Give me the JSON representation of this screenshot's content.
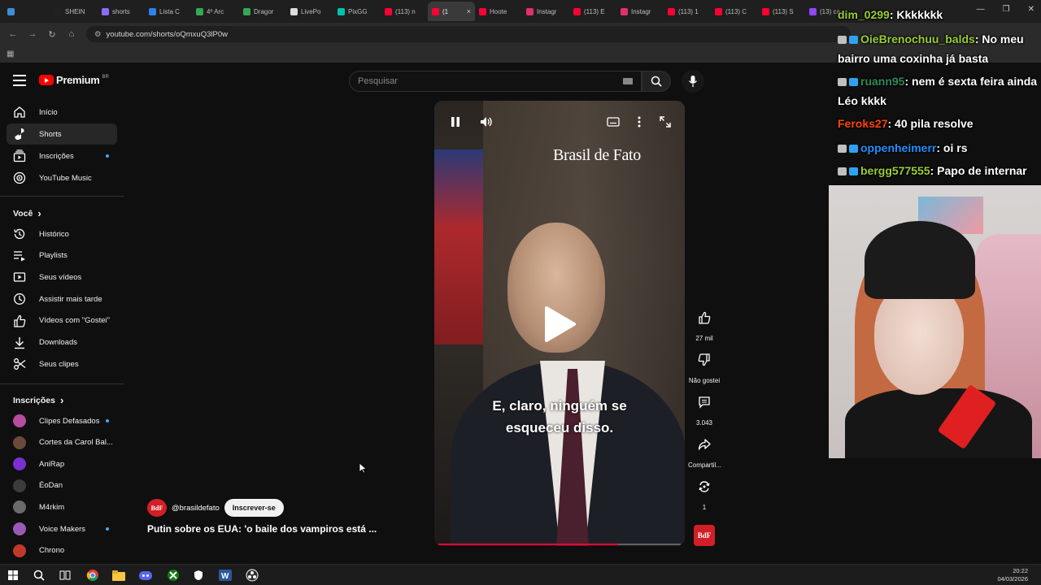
{
  "browser": {
    "tabs": [
      {
        "label": "",
        "color": "#3d8bd9"
      },
      {
        "label": "SHEIN",
        "color": "#222222"
      },
      {
        "label": "shorts",
        "color": "#8a6cff"
      },
      {
        "label": "Lista C",
        "color": "#2f80ed"
      },
      {
        "label": "4º Arc",
        "color": "#34a853"
      },
      {
        "label": "Dragor",
        "color": "#34a853"
      },
      {
        "label": "LivePo",
        "color": "#dddddd"
      },
      {
        "label": "PixGG",
        "color": "#00c2a8"
      },
      {
        "label": "(113) n",
        "color": "#ff0033"
      },
      {
        "label": "(1",
        "color": "#ff0033",
        "active": true,
        "close": "×"
      },
      {
        "label": "Hoote",
        "color": "#ff0033"
      },
      {
        "label": "Instagr",
        "color": "#e1306c"
      },
      {
        "label": "(113) E",
        "color": "#ff0033"
      },
      {
        "label": "Instagr",
        "color": "#e1306c"
      },
      {
        "label": "(113) 1",
        "color": "#ff0033"
      },
      {
        "label": "(113) C",
        "color": "#ff0033"
      },
      {
        "label": "(113) S",
        "color": "#ff0033"
      },
      {
        "label": "(13) ca",
        "color": "#9146ff"
      }
    ],
    "url": "youtube.com/shorts/oQmxuQ3lP0w"
  },
  "youtube": {
    "brand": "Premium",
    "region": "BR",
    "search_placeholder": "Pesquisar",
    "sidebar": {
      "main": [
        {
          "label": "Início",
          "icon": "home-icon"
        },
        {
          "label": "Shorts",
          "icon": "shorts-icon",
          "active": true
        },
        {
          "label": "Inscrições",
          "icon": "subscriptions-icon",
          "dot": true
        },
        {
          "label": "YouTube Music",
          "icon": "music-icon"
        }
      ],
      "you_heading": "Você",
      "you": [
        {
          "label": "Histórico",
          "icon": "history-icon"
        },
        {
          "label": "Playlists",
          "icon": "playlists-icon"
        },
        {
          "label": "Seus vídeos",
          "icon": "your-videos-icon"
        },
        {
          "label": "Assistir mais tarde",
          "icon": "watch-later-icon"
        },
        {
          "label": "Vídeos com \"Gostei\"",
          "icon": "liked-icon"
        },
        {
          "label": "Downloads",
          "icon": "download-icon"
        },
        {
          "label": "Seus clipes",
          "icon": "clips-icon"
        }
      ],
      "subs_heading": "Inscrições",
      "subs": [
        {
          "label": "Clipes Defasados",
          "color": "#b84c9c",
          "dot": true
        },
        {
          "label": "Cortes da Carol Bal...",
          "color": "#6b4a3c"
        },
        {
          "label": "AniRap",
          "color": "#7a2fd0"
        },
        {
          "label": "ÉoDan",
          "color": "#3b3b3b"
        },
        {
          "label": "M4rkim",
          "color": "#6a6a6a"
        },
        {
          "label": "Voice Makers",
          "color": "#9b59b6",
          "dot": true
        },
        {
          "label": "Chrono",
          "color": "#c0392b"
        }
      ]
    },
    "video": {
      "watermark": "Brasil de Fato",
      "subtitle_line1": "E, claro, ninguém se",
      "subtitle_line2": "esqueceu disso.",
      "progress": 0.74,
      "channel_handle": "@brasildefato",
      "channel_logo": "BdF",
      "subscribe_label": "Inscrever-se",
      "title": "Putin sobre os EUA: 'o baile dos vampiros está ..."
    },
    "actions": {
      "likes": "27 mil",
      "dislike_label": "Não gostei",
      "comments": "3.043",
      "share_label": "Compartil...",
      "remix_count": "1"
    }
  },
  "stream": {
    "chat": [
      {
        "user": "dim_0299",
        "text": ": Kkkkkkk",
        "color": "#9acd32"
      },
      {
        "user": "OieBrenochuu_balds",
        "text": ": No meu bairro uma coxinha já basta",
        "color": "#9acd32"
      },
      {
        "user": "ruann95",
        "text": ": nem é sexta feira ainda Léo kkkk",
        "color": "#2e8b57"
      },
      {
        "user": "Feroks27",
        "text": ": 40 pila resolve",
        "color": "#ff4500"
      },
      {
        "user": "oppenheimerr",
        "text": ": oi rs",
        "color": "#1e90ff"
      },
      {
        "user": "bergg577555",
        "text": ": Papo de internar",
        "color": "#9acd32"
      }
    ]
  },
  "taskbar": {
    "time": "20:22",
    "date": "04/03/2026"
  }
}
